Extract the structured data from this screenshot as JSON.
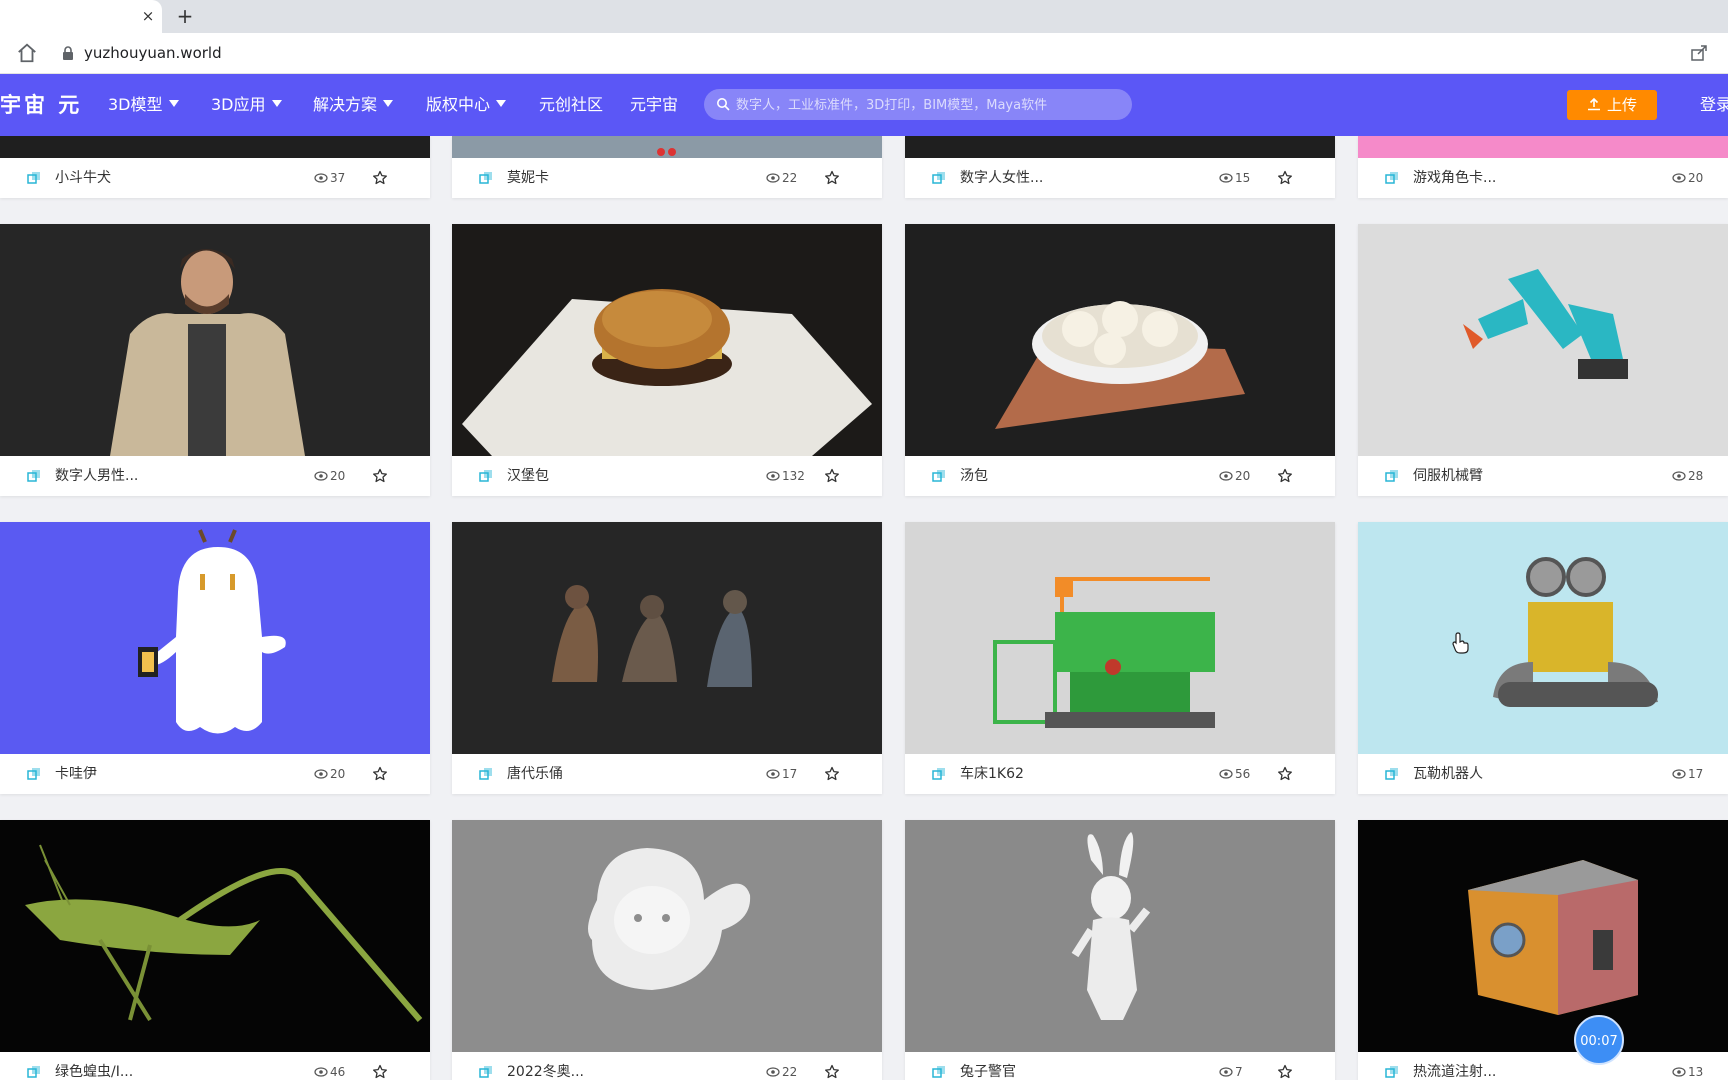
{
  "browser": {
    "url": "yuzhouyuan.world",
    "tab_close": "×",
    "new_tab": "+"
  },
  "nav": {
    "logo": "宇宙 元",
    "items": [
      {
        "label": "3D模型",
        "dropdown": true
      },
      {
        "label": "3D应用",
        "dropdown": true
      },
      {
        "label": "解决方案",
        "dropdown": true
      },
      {
        "label": "版权中心",
        "dropdown": true
      },
      {
        "label": "元创社区",
        "dropdown": false
      },
      {
        "label": "元宇宙",
        "dropdown": false
      }
    ],
    "search_placeholder": "数字人，工业标准件，3D打印，BIM模型，Maya软件",
    "upload_label": "上传",
    "login_label": "登录",
    "accent_color": "#5b57f6",
    "upload_color": "#ff8a00"
  },
  "models": [
    {
      "title": "小斗牛犬",
      "views": "37"
    },
    {
      "title": "莫妮卡",
      "views": "22"
    },
    {
      "title": "数字人女性...",
      "views": "15"
    },
    {
      "title": "游戏角色卡...",
      "views": "20"
    },
    {
      "title": "数字人男性...",
      "views": "20"
    },
    {
      "title": "汉堡包",
      "views": "132"
    },
    {
      "title": "汤包",
      "views": "20"
    },
    {
      "title": "伺服机械臂",
      "views": "28"
    },
    {
      "title": "卡哇伊",
      "views": "20"
    },
    {
      "title": "唐代乐俑",
      "views": "17"
    },
    {
      "title": "车床1K62",
      "views": "56"
    },
    {
      "title": "瓦勒机器人",
      "views": "17"
    },
    {
      "title": "绿色蝗虫/I...",
      "views": "46"
    },
    {
      "title": "2022冬奥...",
      "views": "22"
    },
    {
      "title": "兔子警官",
      "views": "7"
    },
    {
      "title": "热流道注射...",
      "views": "13"
    }
  ],
  "timer": "00:07"
}
